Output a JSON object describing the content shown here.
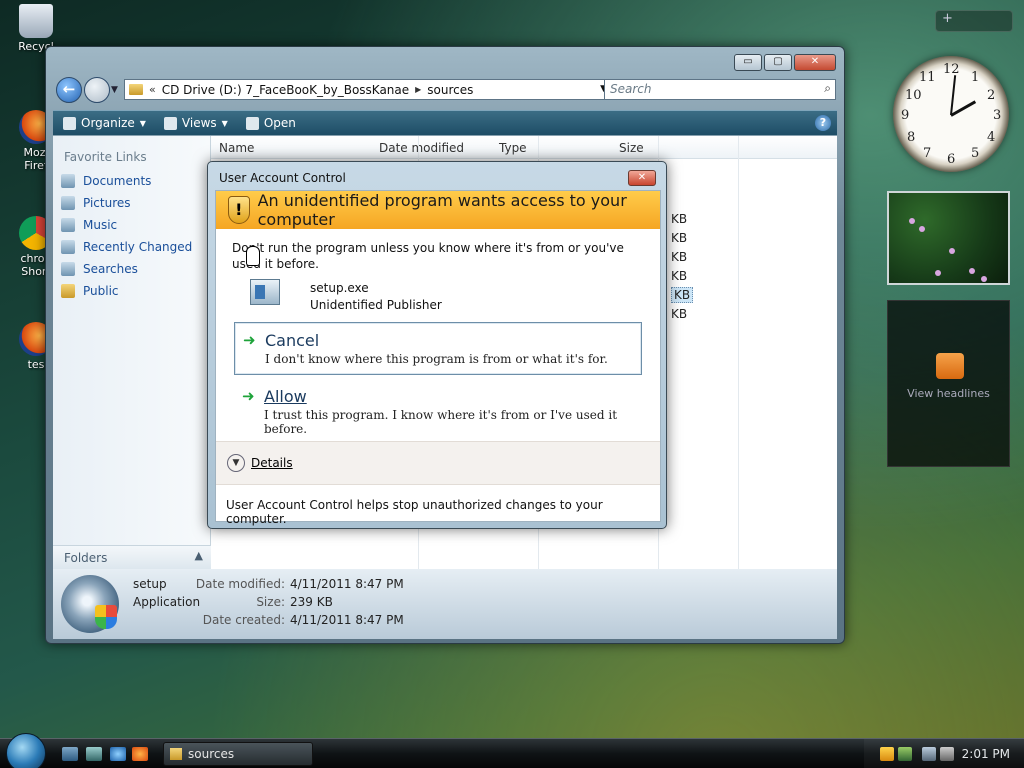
{
  "desktop": {
    "icons": [
      {
        "label": "Recycl"
      },
      {
        "label": "Mozi\nFiref"
      },
      {
        "label": "chron\nShort"
      },
      {
        "label": "tes"
      }
    ]
  },
  "explorer": {
    "controls": {
      "minimize": "▭",
      "maximize": "▢",
      "close": "✕"
    },
    "address": {
      "overflow": "«",
      "crumbs": [
        "CD Drive (D:) 7_FaceBooK_by_BossKanae",
        "sources"
      ]
    },
    "search_placeholder": "Search",
    "toolbar": {
      "organize": "Organize",
      "views": "Views",
      "open": "Open",
      "help": "?"
    },
    "nav_pane": {
      "title": "Favorite Links",
      "links": [
        "Documents",
        "Pictures",
        "Music",
        "Recently Changed",
        "Searches",
        "Public"
      ],
      "folders_label": "Folders"
    },
    "columns": {
      "name": "Name",
      "date_modified": "Date modified",
      "type": "Type",
      "size": "Size"
    },
    "size_suffixes": [
      "KB",
      "KB",
      "KB",
      "KB",
      "KB",
      "KB"
    ],
    "details": {
      "name": "setup",
      "kind": "Application",
      "date_modified_label": "Date modified:",
      "date_modified": "4/11/2011 8:47 PM",
      "size_label": "Size:",
      "size": "239 KB",
      "date_created_label": "Date created:",
      "date_created": "4/11/2011 8:47 PM"
    }
  },
  "uac": {
    "title": "User Account Control",
    "close": "✕",
    "headline": "An unidentified program wants access to your computer",
    "warning": "Don't run the program unless you know where it's from or you've used it before.",
    "program": "setup.exe",
    "publisher": "Unidentified Publisher",
    "cancel": {
      "title": "Cancel",
      "desc": "I don't know where this program is from or what it's for."
    },
    "allow": {
      "title": "Allow",
      "desc": "I trust this program. I know where it's from or I've used it before."
    },
    "details": "Details",
    "footer": "User Account Control helps stop unauthorized changes to your computer."
  },
  "gadgets": {
    "feed_label": "View headlines",
    "clock_numbers": [
      "12",
      "1",
      "2",
      "3",
      "4",
      "5",
      "6",
      "7",
      "8",
      "9",
      "10",
      "11"
    ],
    "clock_time": "2:01"
  },
  "taskbar": {
    "window_button": "sources",
    "time": "2:01 PM"
  }
}
